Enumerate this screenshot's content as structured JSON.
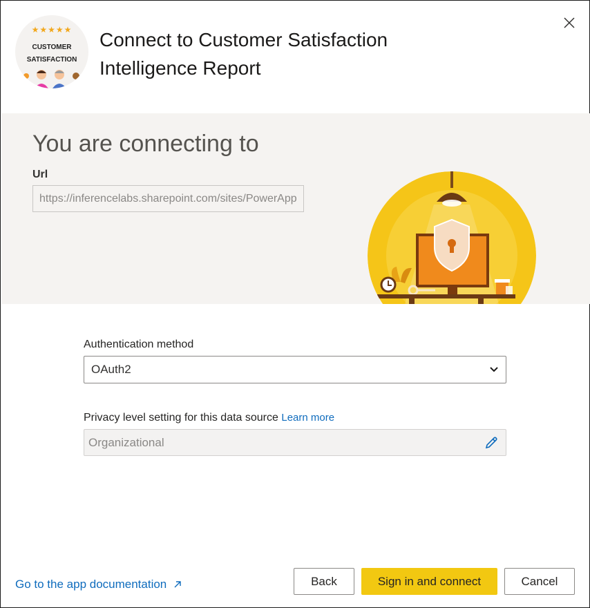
{
  "header": {
    "logo_stars": "★★★★★",
    "logo_line1": "CUSTOMER",
    "logo_line2": "SATISFACTION",
    "title_line1": "Connect to Customer Satisfaction",
    "title_line2": "Intelligence Report"
  },
  "connection": {
    "heading": "You are connecting to",
    "url_label": "Url",
    "url_value": "https://inferencelabs.sharepoint.com/sites/PowerApps"
  },
  "form": {
    "auth_label": "Authentication method",
    "auth_value": "OAuth2",
    "privacy_label": "Privacy level setting for this data source",
    "learn_more": "Learn more",
    "privacy_value": "Organizational"
  },
  "footer": {
    "doc_link": "Go to the app documentation",
    "back": "Back",
    "sign_in": "Sign in and connect",
    "cancel": "Cancel"
  },
  "colors": {
    "accent_yellow": "#f2c811",
    "link_blue": "#0f6cbd",
    "band_background": "#f5f3f1"
  },
  "icons": {
    "close": "close-icon",
    "dropdown": "chevron-down-icon",
    "edit": "pencil-icon",
    "external": "external-link-icon"
  }
}
